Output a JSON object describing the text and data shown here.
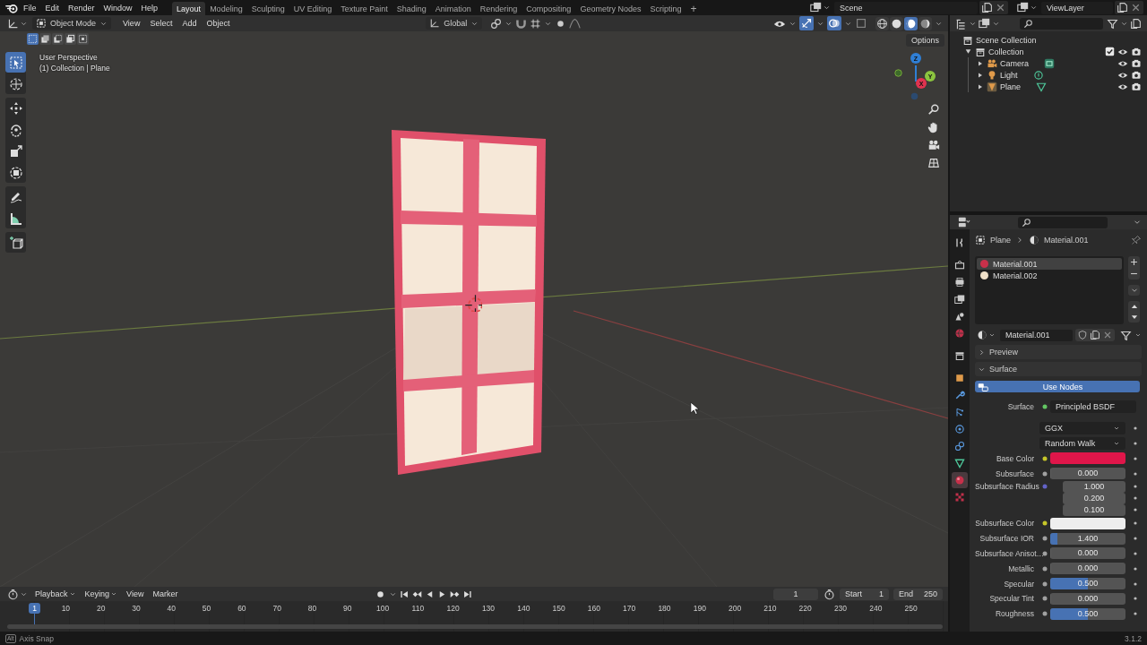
{
  "top_bar": {
    "menus": [
      "File",
      "Edit",
      "Render",
      "Window",
      "Help"
    ],
    "workspaces": [
      {
        "label": "Layout",
        "selected": true
      },
      {
        "label": "Modeling",
        "selected": false
      },
      {
        "label": "Sculpting",
        "selected": false
      },
      {
        "label": "UV Editing",
        "selected": false
      },
      {
        "label": "Texture Paint",
        "selected": false
      },
      {
        "label": "Shading",
        "selected": false
      },
      {
        "label": "Animation",
        "selected": false
      },
      {
        "label": "Rendering",
        "selected": false
      },
      {
        "label": "Compositing",
        "selected": false
      },
      {
        "label": "Geometry Nodes",
        "selected": false
      },
      {
        "label": "Scripting",
        "selected": false
      }
    ],
    "add_workspace": "+",
    "scene": "Scene",
    "view_layer": "ViewLayer"
  },
  "viewport": {
    "mode": "Object Mode",
    "menus": [
      "View",
      "Select",
      "Add",
      "Object"
    ],
    "orientation": "Global",
    "shading": [
      {
        "kind": "wireframe",
        "selected": false
      },
      {
        "kind": "solid",
        "selected": false
      },
      {
        "kind": "material",
        "selected": true
      },
      {
        "kind": "rendered",
        "selected": false
      }
    ],
    "select_modes": [
      {
        "kind": "new",
        "selected": true
      },
      {
        "kind": "extend",
        "selected": false
      },
      {
        "kind": "subtract",
        "selected": false
      },
      {
        "kind": "difference",
        "selected": false
      },
      {
        "kind": "intersect",
        "selected": false
      }
    ],
    "options": "Options",
    "info": [
      "User Perspective",
      "(1) Collection | Plane"
    ],
    "tool_groups": [
      [
        {
          "kind": "select",
          "selected": true
        },
        {
          "kind": "cursor",
          "selected": false
        }
      ],
      [
        {
          "kind": "move",
          "selected": false
        },
        {
          "kind": "rotate",
          "selected": false
        },
        {
          "kind": "scale",
          "selected": false
        },
        {
          "kind": "transform",
          "selected": false
        }
      ],
      [
        {
          "kind": "annotate",
          "selected": false
        },
        {
          "kind": "measure",
          "selected": false
        }
      ],
      [
        {
          "kind": "add_cube",
          "selected": false
        }
      ]
    ],
    "gizmo_axes": [
      {
        "label": "Z",
        "color": "#2f7fd6"
      },
      {
        "label": "Y",
        "color": "#8bc43f"
      },
      {
        "label": "X",
        "color": "#e0334f"
      }
    ],
    "scene_view": {
      "kind": "picture"
    }
  },
  "outliner": {
    "root": "Scene Collection",
    "collections": [
      {
        "label": "Collection",
        "expanded": true,
        "checked": true,
        "objects": [
          {
            "label": "Camera",
            "kind": "camera",
            "expanded": false
          },
          {
            "label": "Light",
            "kind": "light",
            "expanded": false
          },
          {
            "label": "Plane",
            "kind": "mesh",
            "expanded": false
          }
        ]
      }
    ]
  },
  "properties": {
    "tabs": [
      {
        "kind": "tool",
        "selected": false
      },
      {
        "kind": "render",
        "selected": false
      },
      {
        "kind": "output",
        "selected": false
      },
      {
        "kind": "view_layer",
        "selected": false
      },
      {
        "kind": "scene",
        "selected": false
      },
      {
        "kind": "world",
        "selected": false
      },
      {
        "kind": "collection",
        "selected": false
      },
      {
        "kind": "object",
        "selected": false
      },
      {
        "kind": "modifiers",
        "selected": false
      },
      {
        "kind": "particles",
        "selected": false
      },
      {
        "kind": "physics",
        "selected": false
      },
      {
        "kind": "constraints",
        "selected": false
      },
      {
        "kind": "data",
        "selected": false
      },
      {
        "kind": "material",
        "selected": true
      },
      {
        "kind": "texture",
        "selected": false
      }
    ],
    "breadcrumb": [
      "Plane",
      "Material.001"
    ],
    "slots": [
      {
        "name": "Material.001",
        "color": "#c8304a",
        "selected": true
      },
      {
        "name": "Material.002",
        "color": "#f0e0c8",
        "selected": false
      }
    ],
    "material": "Material.001",
    "panels": [
      {
        "label": "Preview",
        "expanded": false
      },
      {
        "label": "Surface",
        "expanded": true
      }
    ],
    "use_nodes": "Use Nodes",
    "fields": [
      {
        "kind": "link",
        "label": "Surface",
        "value": "Principled BSDF"
      },
      {
        "kind": "dropdown",
        "value": "GGX"
      },
      {
        "kind": "dropdown",
        "value": "Random Walk"
      },
      {
        "kind": "color",
        "label": "Base Color",
        "color": "#e0164a"
      },
      {
        "kind": "number",
        "label": "Subsurface",
        "value": "0.000",
        "level": 0
      },
      {
        "kind": "vector",
        "label": "Subsurface Radius",
        "values": [
          "1.000",
          "0.200",
          "0.100"
        ]
      },
      {
        "kind": "color",
        "label": "Subsurface Color",
        "color": "#eeeeee"
      },
      {
        "kind": "number",
        "label": "Subsurface IOR",
        "value": "1.400",
        "level": 0.1
      },
      {
        "kind": "number",
        "label": "Subsurface Anisot…",
        "value": "0.000",
        "level": 0
      },
      {
        "kind": "number",
        "label": "Metallic",
        "value": "0.000",
        "level": 0
      },
      {
        "kind": "number",
        "label": "Specular",
        "value": "0.500",
        "level": 0.5
      },
      {
        "kind": "number",
        "label": "Specular Tint",
        "value": "0.000",
        "level": 0
      },
      {
        "kind": "number",
        "label": "Roughness",
        "value": "0.500",
        "level": 0.5
      }
    ]
  },
  "timeline": {
    "menus": [
      "Playback",
      "Keying",
      "View",
      "Marker"
    ],
    "playhead": "1",
    "ruler": [
      "10",
      "20",
      "30",
      "40",
      "50",
      "60",
      "70",
      "80",
      "90",
      "100",
      "110",
      "120",
      "130",
      "140",
      "150",
      "160",
      "170",
      "180",
      "190",
      "200",
      "210",
      "220",
      "230",
      "240",
      "250"
    ],
    "current_frame": "1",
    "start_label": "Start",
    "start": "1",
    "end_label": "End",
    "end": "250"
  },
  "status_bar": {
    "key": "Alt",
    "hint": "Axis Snap",
    "version": "3.1.2"
  }
}
